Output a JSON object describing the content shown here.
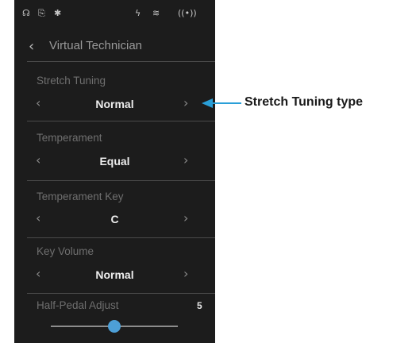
{
  "status_bar": {
    "icons": [
      "headphones-icon",
      "usb-icon",
      "bluetooth-icon",
      "power-icon",
      "audio-wave-icon",
      "wireless-icon"
    ],
    "glyphs": [
      "☊",
      "⎘",
      "✱",
      "ϟ",
      "≋",
      "((•))"
    ]
  },
  "header": {
    "back_glyph": "‹",
    "title": "Virtual Technician"
  },
  "settings": [
    {
      "label": "Stretch Tuning",
      "value": "Normal"
    },
    {
      "label": "Temperament",
      "value": "Equal"
    },
    {
      "label": "Temperament Key",
      "value": "C"
    },
    {
      "label": "Key Volume",
      "value": "Normal"
    }
  ],
  "arrows": {
    "prev": "‹",
    "next": "›"
  },
  "half_pedal": {
    "label": "Half-Pedal Adjust",
    "value": "5",
    "level_fraction": 0.5
  },
  "callout": {
    "text": "Stretch Tuning type",
    "color": "#2a9fd8"
  },
  "colors": {
    "screen_bg": "#1c1c1c",
    "accent": "#4d9fd6"
  }
}
